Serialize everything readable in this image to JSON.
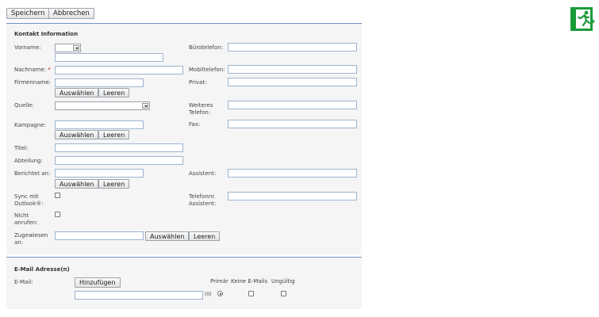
{
  "toolbar": {
    "save_label": "Speichern",
    "cancel_label": "Abbrechen"
  },
  "contact_section": {
    "title": "Kontakt Information",
    "labels": {
      "vorname": "Vorname:",
      "nachname": "Nachname:",
      "required_marker": "*",
      "firmenname": "Firmenname:",
      "quelle": "Quelle:",
      "kampagne": "Kampagne:",
      "titel": "Titel:",
      "abteilung": "Abteilung:",
      "berichtet_an": "Berichtet an:",
      "sync_outlook": "Sync mit Outlook®:",
      "nicht_anrufen": "Nicht anrufen:",
      "zugewiesen_an": "Zugewiesen an:",
      "buerotelefon": "Bürotelefon:",
      "mobiltelefon": "Mobiltelefon:",
      "privat": "Privat:",
      "weiteres_telefon": "Weiteres Telefon:",
      "fax": "Fax:",
      "assistent": "Assistent:",
      "telefonnr_assistent": "Telefonnr. Assistent:"
    },
    "buttons": {
      "select": "Auswählen",
      "clear": "Leeren"
    }
  },
  "email_section": {
    "title": "E-Mail Adresse(n)",
    "label": "E-Mail:",
    "add_button": "Hinzufügen",
    "col_primary": "Primär",
    "col_no_mail": "Keine E-Mails",
    "col_invalid": "Ungültig",
    "row_marker": "(0)",
    "primary_selected": true
  },
  "logo": {
    "icon": "exit-door-icon",
    "color": "#1a9b3a"
  }
}
